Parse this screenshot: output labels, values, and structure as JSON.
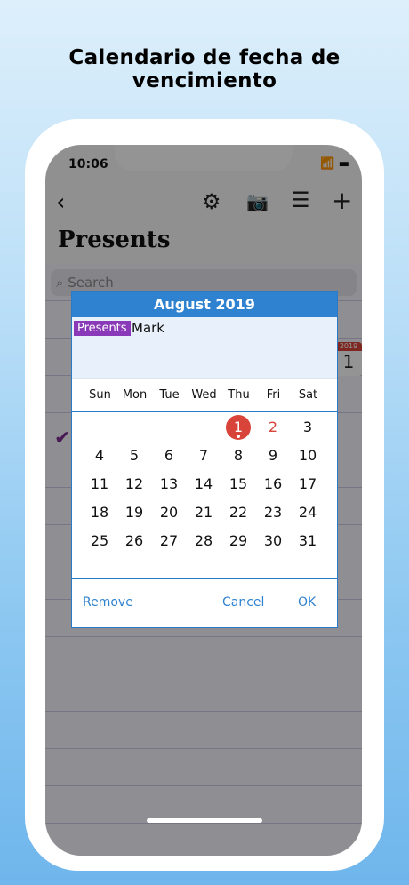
{
  "caption": "Calendario de fecha de vencimiento",
  "status": {
    "time": "10:06"
  },
  "header": {
    "title": "Presents"
  },
  "search": {
    "placeholder": "Search"
  },
  "badge": {
    "year": "2019",
    "day": "1"
  },
  "dialog": {
    "title": "August 2019",
    "tag": "Presents",
    "event_name": "Mark",
    "weekdays": [
      "Sun",
      "Mon",
      "Tue",
      "Wed",
      "Thu",
      "Fri",
      "Sat"
    ],
    "today": 1,
    "selected_red": 2,
    "days": [
      [
        "",
        "",
        "",
        "",
        "1",
        "2",
        "3"
      ],
      [
        "4",
        "5",
        "6",
        "7",
        "8",
        "9",
        "10"
      ],
      [
        "11",
        "12",
        "13",
        "14",
        "15",
        "16",
        "17"
      ],
      [
        "18",
        "19",
        "20",
        "21",
        "22",
        "23",
        "24"
      ],
      [
        "25",
        "26",
        "27",
        "28",
        "29",
        "30",
        "31"
      ]
    ],
    "buttons": {
      "remove": "Remove",
      "cancel": "Cancel",
      "ok": "OK"
    }
  },
  "colors": {
    "accent": "#2f82cf",
    "today": "#d9443a",
    "tag": "#8a3ab8"
  }
}
